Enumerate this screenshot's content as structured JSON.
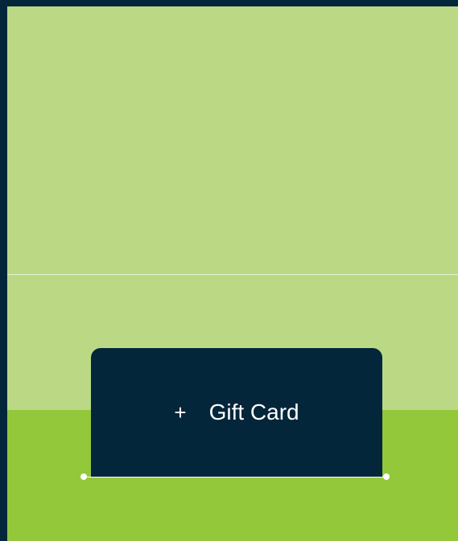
{
  "card": {
    "plus_icon": "+",
    "label": "Gift Card"
  },
  "colors": {
    "frame": "#04263a",
    "panel_light": "#bbd985",
    "panel_green": "#93c83a",
    "card": "#04263a",
    "text": "#ffffff"
  }
}
